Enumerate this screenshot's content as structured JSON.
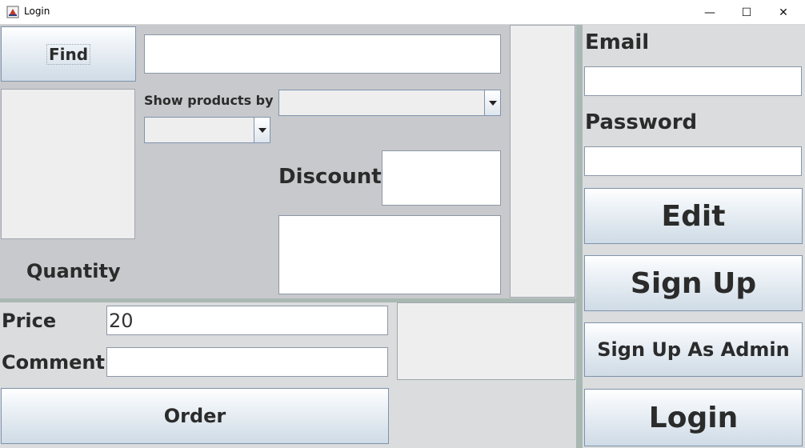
{
  "window": {
    "title": "Login",
    "app_icon": "java-cup-icon",
    "controls": {
      "minimize": "—",
      "maximize": "☐",
      "close": "✕"
    }
  },
  "left": {
    "find_button": "Find",
    "search_field": {
      "value": ""
    },
    "show_products_label": "Show products by",
    "discount_label": "Discount",
    "quantity_label": "Quantity"
  },
  "bottom": {
    "price_label": "Price",
    "price_value": "20",
    "comment_label": "Comment",
    "comment_value": "",
    "order_button": "Order"
  },
  "right": {
    "email_label": "Email",
    "password_label": "Password",
    "edit_button": "Edit",
    "signup_button": "Sign Up",
    "signup_admin_button": "Sign Up As Admin",
    "login_button": "Login"
  }
}
